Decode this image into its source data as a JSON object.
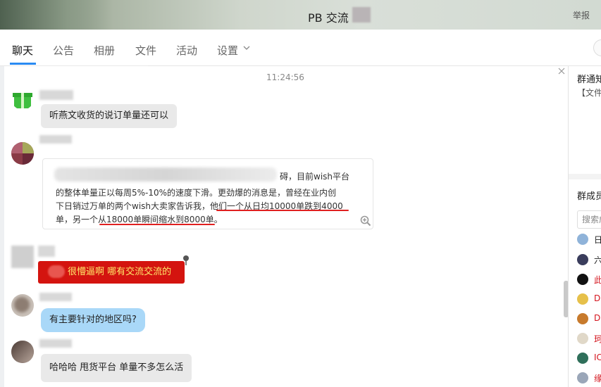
{
  "window": {
    "title": "PB 交流",
    "report_label": "举报"
  },
  "tabs": [
    {
      "label": "聊天",
      "active": true
    },
    {
      "label": "公告",
      "active": false
    },
    {
      "label": "相册",
      "active": false
    },
    {
      "label": "文件",
      "active": false
    },
    {
      "label": "活动",
      "active": false
    },
    {
      "label": "设置",
      "active": false
    }
  ],
  "chat": {
    "timestamp": "11:24:56",
    "messages": [
      {
        "text": "听燕文收货的说订单量还可以",
        "style": "gray"
      },
      {
        "style": "card",
        "lines": [
          "碍，目前wish平台",
          "的整体单量正以每周5%-10%的速度下滑。更劲爆的消息是，曾经在业内创",
          "下日销过万单的两个wish大卖家告诉我，他们一个从日均10000单跌到4000",
          "单，另一个从18000单瞬间缩水到8000单。"
        ]
      },
      {
        "text": "很懵逼啊  哪有交流交流的",
        "style": "red"
      },
      {
        "text": "有主要针对的地区吗?",
        "style": "blue"
      },
      {
        "text": "哈哈哈  甩货平台  单量不多怎么活",
        "style": "gray"
      }
    ]
  },
  "right_panel": {
    "notice_title": "群通知",
    "notice_item": "【文件】",
    "members_title": "群成员",
    "search_placeholder": "搜索成员",
    "members": [
      {
        "name": "日",
        "color": "#222222"
      },
      {
        "name": "六",
        "color": "#222222"
      },
      {
        "name": "此",
        "color": "#d4141d"
      },
      {
        "name": "D",
        "color": "#d4141d"
      },
      {
        "name": "D",
        "color": "#d4141d"
      },
      {
        "name": "珂",
        "color": "#d4141d"
      },
      {
        "name": "IC",
        "color": "#d4141d"
      },
      {
        "name": "缘",
        "color": "#d4141d"
      }
    ]
  },
  "colors": {
    "accent": "#2a8bf2",
    "red_bubble": "#d4140f",
    "blue_bubble": "#a9d8f8",
    "gray_bubble": "#e9e9e9",
    "underline": "#e02020"
  },
  "icons": [
    "chevron-down-icon",
    "zoom-in-icon",
    "close-icon",
    "pin-icon",
    "gift-icon"
  ]
}
